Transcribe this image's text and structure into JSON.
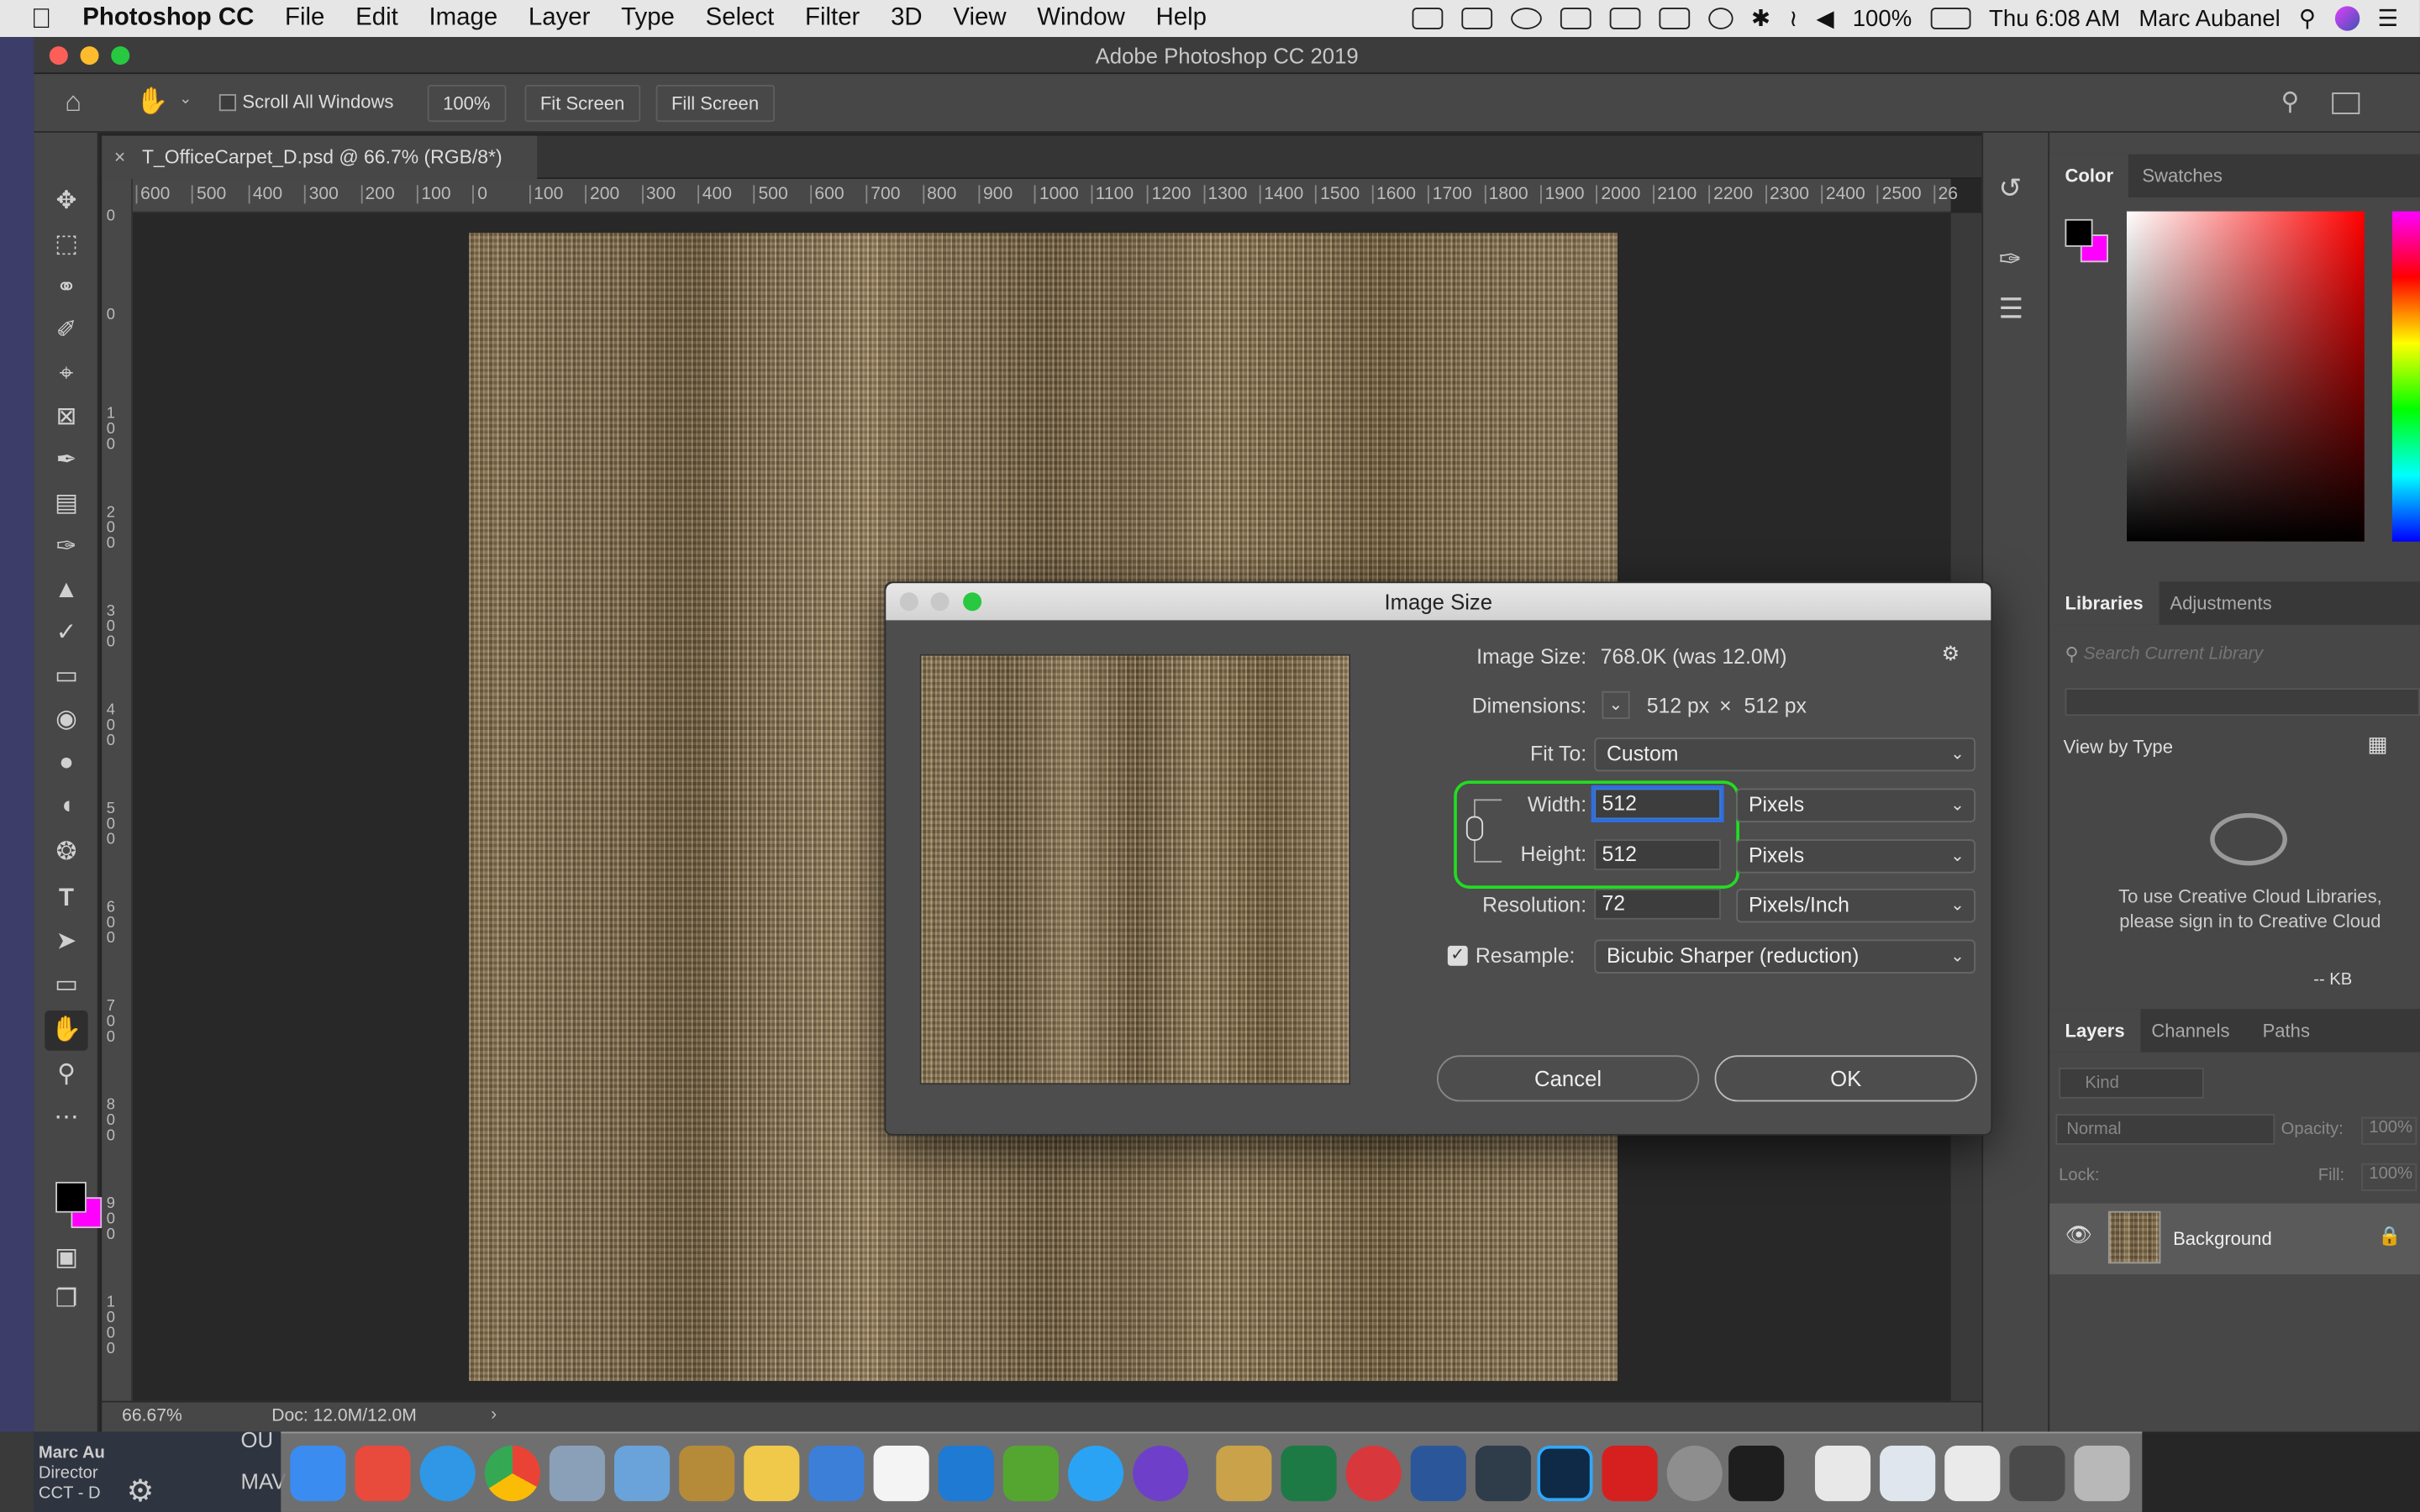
{
  "menubar": {
    "app": "Photoshop CC",
    "items": [
      "File",
      "Edit",
      "Image",
      "Layer",
      "Type",
      "Select",
      "Filter",
      "3D",
      "View",
      "Window",
      "Help"
    ],
    "battery": "100%",
    "clock": "Thu 6:08 AM",
    "user": "Marc Aubanel"
  },
  "window": {
    "title": "Adobe Photoshop CC 2019"
  },
  "options": {
    "scroll_all": "Scroll All Windows",
    "zoom": "100%",
    "fit_screen": "Fit Screen",
    "fill_screen": "Fill Screen"
  },
  "document": {
    "tab_title": "T_OfficeCarpet_D.psd @ 66.7% (RGB/8*)",
    "ruler_h": [
      "600",
      "500",
      "400",
      "300",
      "200",
      "100",
      "0",
      "100",
      "200",
      "300",
      "400",
      "500",
      "600",
      "700",
      "800",
      "900",
      "1000",
      "1100",
      "1200",
      "1300",
      "1400",
      "1500",
      "1600",
      "1700",
      "1800",
      "1900",
      "2000",
      "2100",
      "2200",
      "2300",
      "2400",
      "2500",
      "26"
    ],
    "ruler_v": [
      "0",
      "0",
      "1 0 0",
      "2 0 0",
      "3 0 0",
      "4 0 0",
      "5 0 0",
      "6 0 0",
      "7 0 0",
      "8 0 0",
      "9 0 0",
      "1 0 0 0"
    ]
  },
  "status": {
    "zoom": "66.67%",
    "doc": "Doc: 12.0M/12.0M"
  },
  "panels": {
    "color_tab": "Color",
    "swatches_tab": "Swatches",
    "libraries_tab": "Libraries",
    "adjustments_tab": "Adjustments",
    "search_placeholder": "Search Current Library",
    "view_by": "View by Type",
    "cc_message": "To use Creative Cloud Libraries, please sign in to Creative Cloud",
    "kb": "-- KB",
    "layers_tab": "Layers",
    "channels_tab": "Channels",
    "paths_tab": "Paths",
    "kind": "Kind",
    "blend": "Normal",
    "opacity_label": "Opacity:",
    "opacity": "100%",
    "lock_label": "Lock:",
    "fill_label": "Fill:",
    "fill": "100%",
    "layer_name": "Background"
  },
  "dialog": {
    "title": "Image Size",
    "image_size_label": "Image Size:",
    "image_size_value": "768.0K (was 12.0M)",
    "dimensions_label": "Dimensions:",
    "dim_w": "512 px",
    "dim_x": "×",
    "dim_h": "512 px",
    "fit_to_label": "Fit To:",
    "fit_to": "Custom",
    "width_label": "Width:",
    "width": "512",
    "width_unit": "Pixels",
    "height_label": "Height:",
    "height": "512",
    "height_unit": "Pixels",
    "resolution_label": "Resolution:",
    "resolution": "72",
    "resolution_unit": "Pixels/Inch",
    "resample_label": "Resample:",
    "resample": "Bicubic Sharper (reduction)",
    "cancel": "Cancel",
    "ok": "OK",
    "highlight_color": "#22dd22"
  },
  "dock_side": {
    "name": "Marc Au",
    "title": "Director",
    "org": "CCT - D",
    "ou": "OU",
    "ma": "MAV"
  },
  "colors": {
    "foreground": "#000000",
    "background": "#ff00ff",
    "accent": "#2f6de0"
  }
}
